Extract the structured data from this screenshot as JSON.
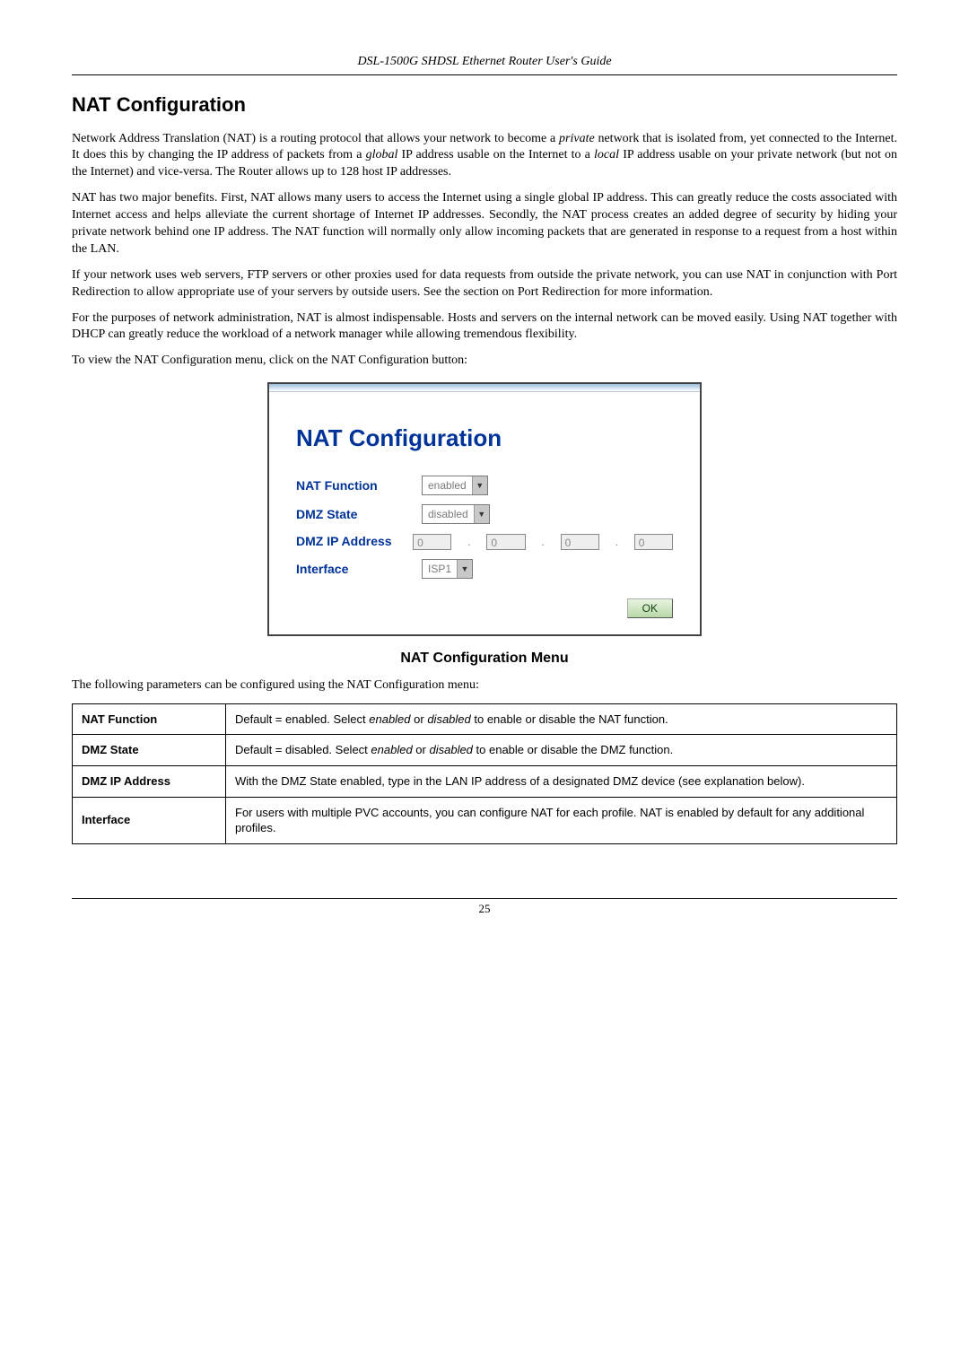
{
  "header": "DSL-1500G SHDSL Ethernet Router User's Guide",
  "section_title": "NAT Configuration",
  "para1_a": "Network Address Translation (NAT) is a routing protocol that allows your network to become a ",
  "para1_b": "private",
  "para1_c": " network that is isolated from, yet connected to the Internet. It does this by changing the IP address of packets from a ",
  "para1_d": "global",
  "para1_e": " IP address usable on the Internet to a ",
  "para1_f": "local",
  "para1_g": " IP address usable on your private network (but not on the Internet) and vice-versa. The Router allows up to 128 host IP addresses.",
  "para2": "NAT has two major benefits. First, NAT allows many users to access the Internet using a single global IP address. This can greatly reduce the costs associated with Internet access and helps alleviate the current shortage of Internet IP addresses. Secondly, the NAT process creates an added degree of security by hiding your private network behind one IP address. The NAT function will normally only allow incoming packets that are generated in response to a request from a host within the LAN.",
  "para3": "If your network uses web servers, FTP servers or other proxies used for data requests from outside the private network, you can use NAT in conjunction with Port Redirection to allow appropriate use of your servers by outside users. See the section on Port Redirection for more information.",
  "para4": "For the purposes of network administration, NAT is almost indispensable. Hosts and servers on the internal network can be moved easily. Using NAT together with DHCP can greatly reduce the workload of a network manager while allowing tremendous flexibility.",
  "para5": "To view the NAT Configuration menu, click on the NAT Configuration button:",
  "figure": {
    "title": "NAT Configuration",
    "rows": {
      "nat_function": {
        "label": "NAT Function",
        "value": "enabled"
      },
      "dmz_state": {
        "label": "DMZ State",
        "value": "disabled"
      },
      "dmz_ip": {
        "label": "DMZ IP Address",
        "oct1": "0",
        "oct2": "0",
        "oct3": "0",
        "oct4": "0"
      },
      "interface": {
        "label": "Interface",
        "value": "ISP1"
      }
    },
    "ok": "OK"
  },
  "fig_caption": "NAT Configuration Menu",
  "para6": "The following parameters can be configured using the NAT Configuration menu:",
  "table": {
    "r1": {
      "name": "NAT Function",
      "a": "Default = enabled. Select ",
      "b": "enabled",
      "c": " or ",
      "d": "disabled",
      "e": " to enable or disable the NAT function."
    },
    "r2": {
      "name": "DMZ State",
      "a": "Default = disabled. Select ",
      "b": "enabled",
      "c": " or ",
      "d": "disabled",
      "e": " to enable or disable the DMZ function."
    },
    "r3": {
      "name": "DMZ IP Address",
      "desc": "With the DMZ State enabled, type in the LAN IP address of a designated DMZ device (see explanation below)."
    },
    "r4": {
      "name": "Interface",
      "desc": "For users with multiple PVC accounts, you can configure NAT for each profile. NAT is enabled by default for any additional profiles."
    }
  },
  "page_number": "25"
}
